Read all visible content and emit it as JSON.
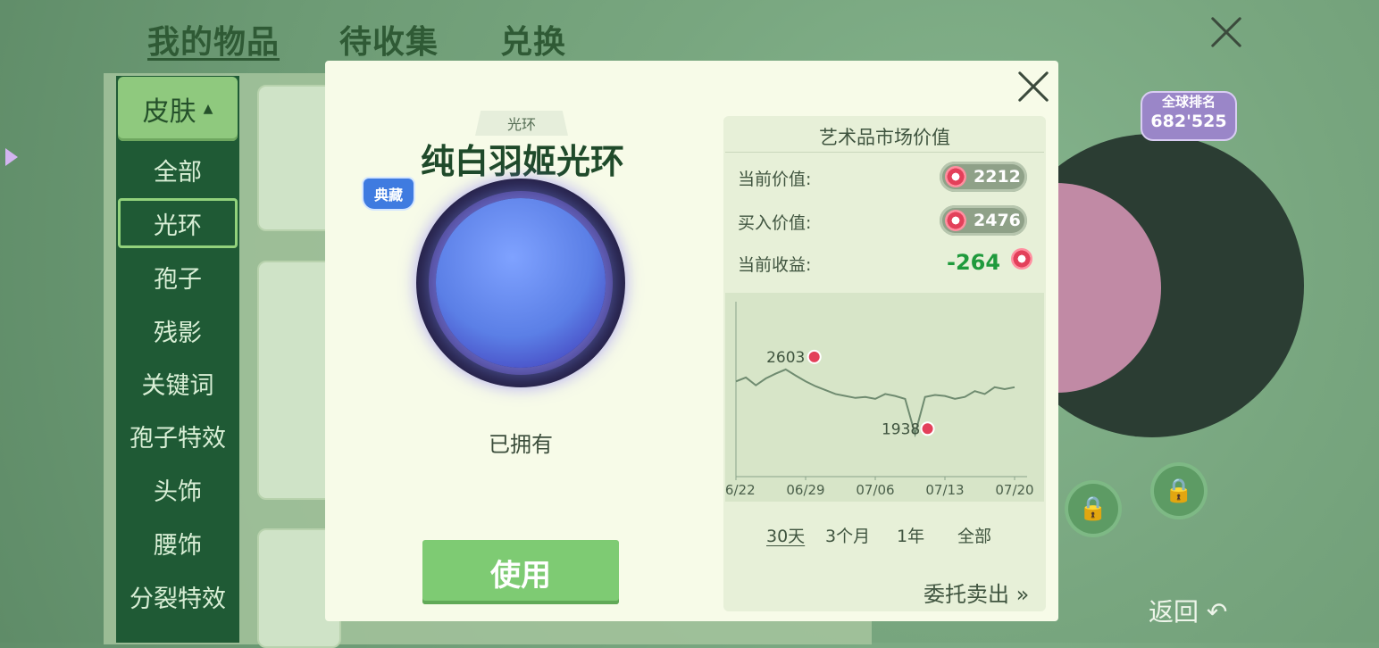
{
  "top_tabs": [
    "我的物品",
    "待收集",
    "兑换"
  ],
  "sidebar": {
    "category": "皮肤",
    "items": [
      "全部",
      "光环",
      "孢子",
      "残影",
      "关键词",
      "孢子特效",
      "头饰",
      "腰饰",
      "分裂特效"
    ],
    "active_index": 1
  },
  "modal": {
    "category_tag": "光环",
    "item_name": "纯白羽姬光环",
    "rarity_badge": "典藏",
    "status": "已拥有",
    "use_button": "使用",
    "market": {
      "title": "艺术品市场价值",
      "current_label": "当前价值:",
      "current_value": "2212",
      "buy_label": "买入价值:",
      "buy_value": "2476",
      "gain_label": "当前收益:",
      "gain_value": "-264",
      "ranges": [
        "30天",
        "3个月",
        "1年",
        "全部"
      ],
      "consign_label": "委托卖出 »",
      "high_label": "2603",
      "low_label": "1938"
    }
  },
  "chart_data": {
    "type": "line",
    "x": [
      "06/22",
      "06/23",
      "06/24",
      "06/25",
      "06/26",
      "06/27",
      "06/28",
      "06/29",
      "06/30",
      "07/01",
      "07/02",
      "07/03",
      "07/04",
      "07/05",
      "07/06",
      "07/07",
      "07/08",
      "07/09",
      "07/10",
      "07/11",
      "07/12",
      "07/13",
      "07/14",
      "07/15",
      "07/16",
      "07/17",
      "07/18",
      "07/19",
      "07/20"
    ],
    "values": [
      2480,
      2520,
      2440,
      2510,
      2560,
      2603,
      2540,
      2480,
      2430,
      2390,
      2350,
      2330,
      2310,
      2320,
      2300,
      2350,
      2330,
      2300,
      1938,
      2320,
      2340,
      2330,
      2300,
      2320,
      2380,
      2350,
      2420,
      2400,
      2420
    ],
    "xticks": [
      "06/22",
      "06/29",
      "07/06",
      "07/13",
      "07/20"
    ],
    "annotations": [
      {
        "label": "2603",
        "x": "06/27",
        "y": 2603
      },
      {
        "label": "1938",
        "x": "07/10",
        "y": 1938
      }
    ],
    "ylim": [
      1500,
      3300
    ]
  },
  "rank": {
    "label": "全球排名",
    "value": "682'525"
  },
  "back_label": "返回",
  "colors": {
    "use_green": "#7ecb73",
    "gain_green": "#1f9a3c",
    "sidebar_bg": "#1f5a35"
  }
}
